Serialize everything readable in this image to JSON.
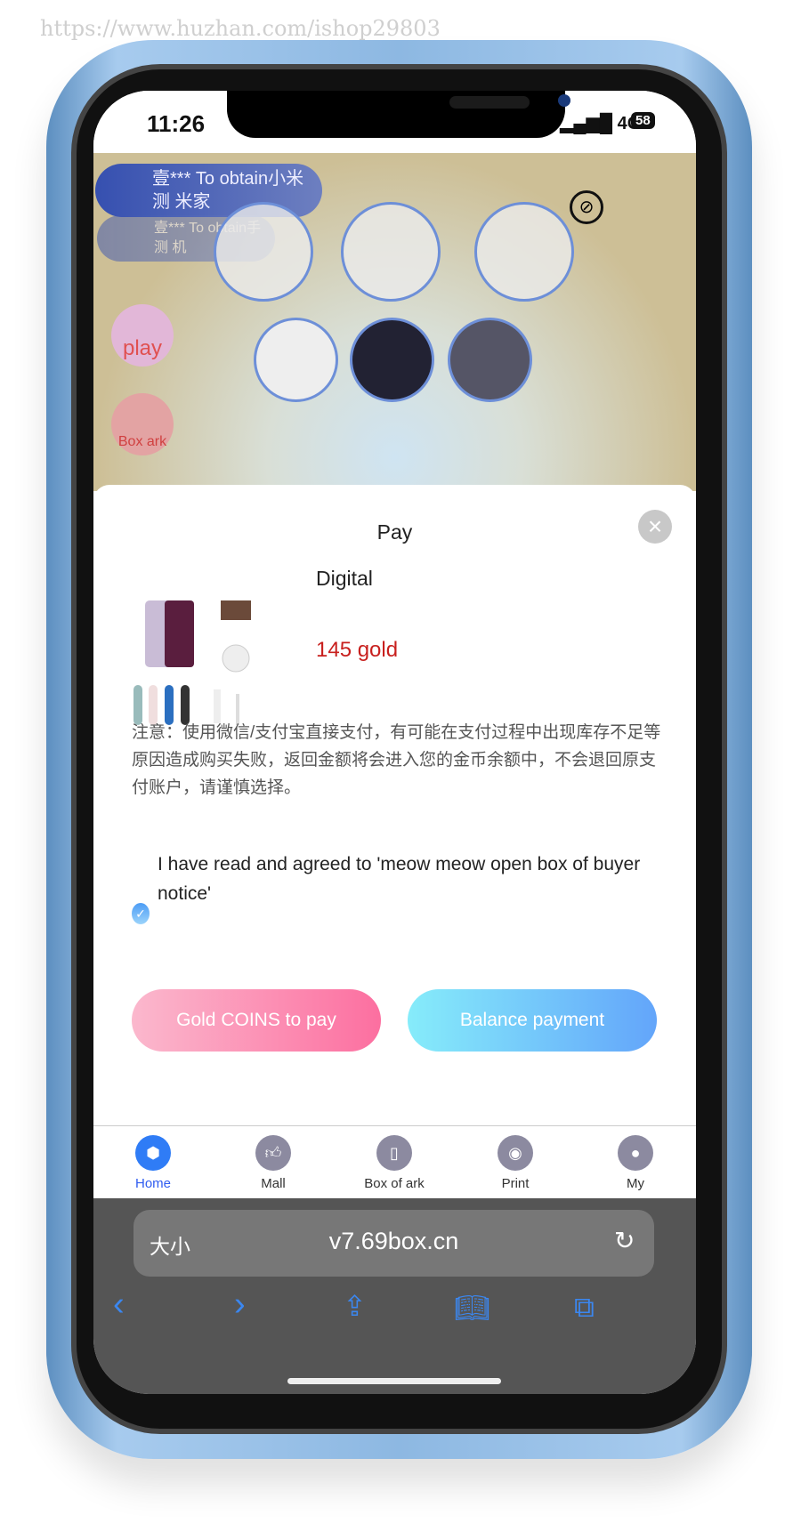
{
  "watermark": "https://www.huzhan.com/ishop29803",
  "status": {
    "time": "11:26",
    "network": "4G",
    "battery": "58"
  },
  "game": {
    "feed": [
      {
        "line1": "壹*** To obtain小米",
        "line2": "测      米家"
      },
      {
        "line1": "壹*** To obtain手",
        "line2": "测      机"
      }
    ],
    "side_buttons": [
      "play",
      "Box ark"
    ],
    "mute_icon": "sound-off-icon"
  },
  "modal": {
    "title": "Pay",
    "close_icon": "close-icon",
    "category": "Digital",
    "price": "145 gold",
    "notice": "注意：使用微信/支付宝直接支付，有可能在支付过程中出现库存不足等原因造成购买失败，返回金额将会进入您的金币余额中，不会退回原支付账户，请谨慎选择。",
    "agreement": "I have read and agreed to 'meow meow open box of buyer notice'",
    "agreed": true,
    "buttons": {
      "gold": "Gold COINS to pay",
      "balance": "Balance payment"
    },
    "colors": {
      "price": "#c8201e",
      "gold_btn": "#fc6fa0",
      "balance_btn": "#63a5fa"
    }
  },
  "tabs": [
    {
      "label": "Home",
      "icon": "cube-icon",
      "active": true
    },
    {
      "label": "Mall",
      "icon": "thumb-icon"
    },
    {
      "label": "Box of ark",
      "icon": "box-icon"
    },
    {
      "label": "Print",
      "icon": "camera-icon"
    },
    {
      "label": "My",
      "icon": "user-icon"
    }
  ],
  "browser": {
    "text_size": "大小",
    "url": "v7.69box.cn"
  }
}
